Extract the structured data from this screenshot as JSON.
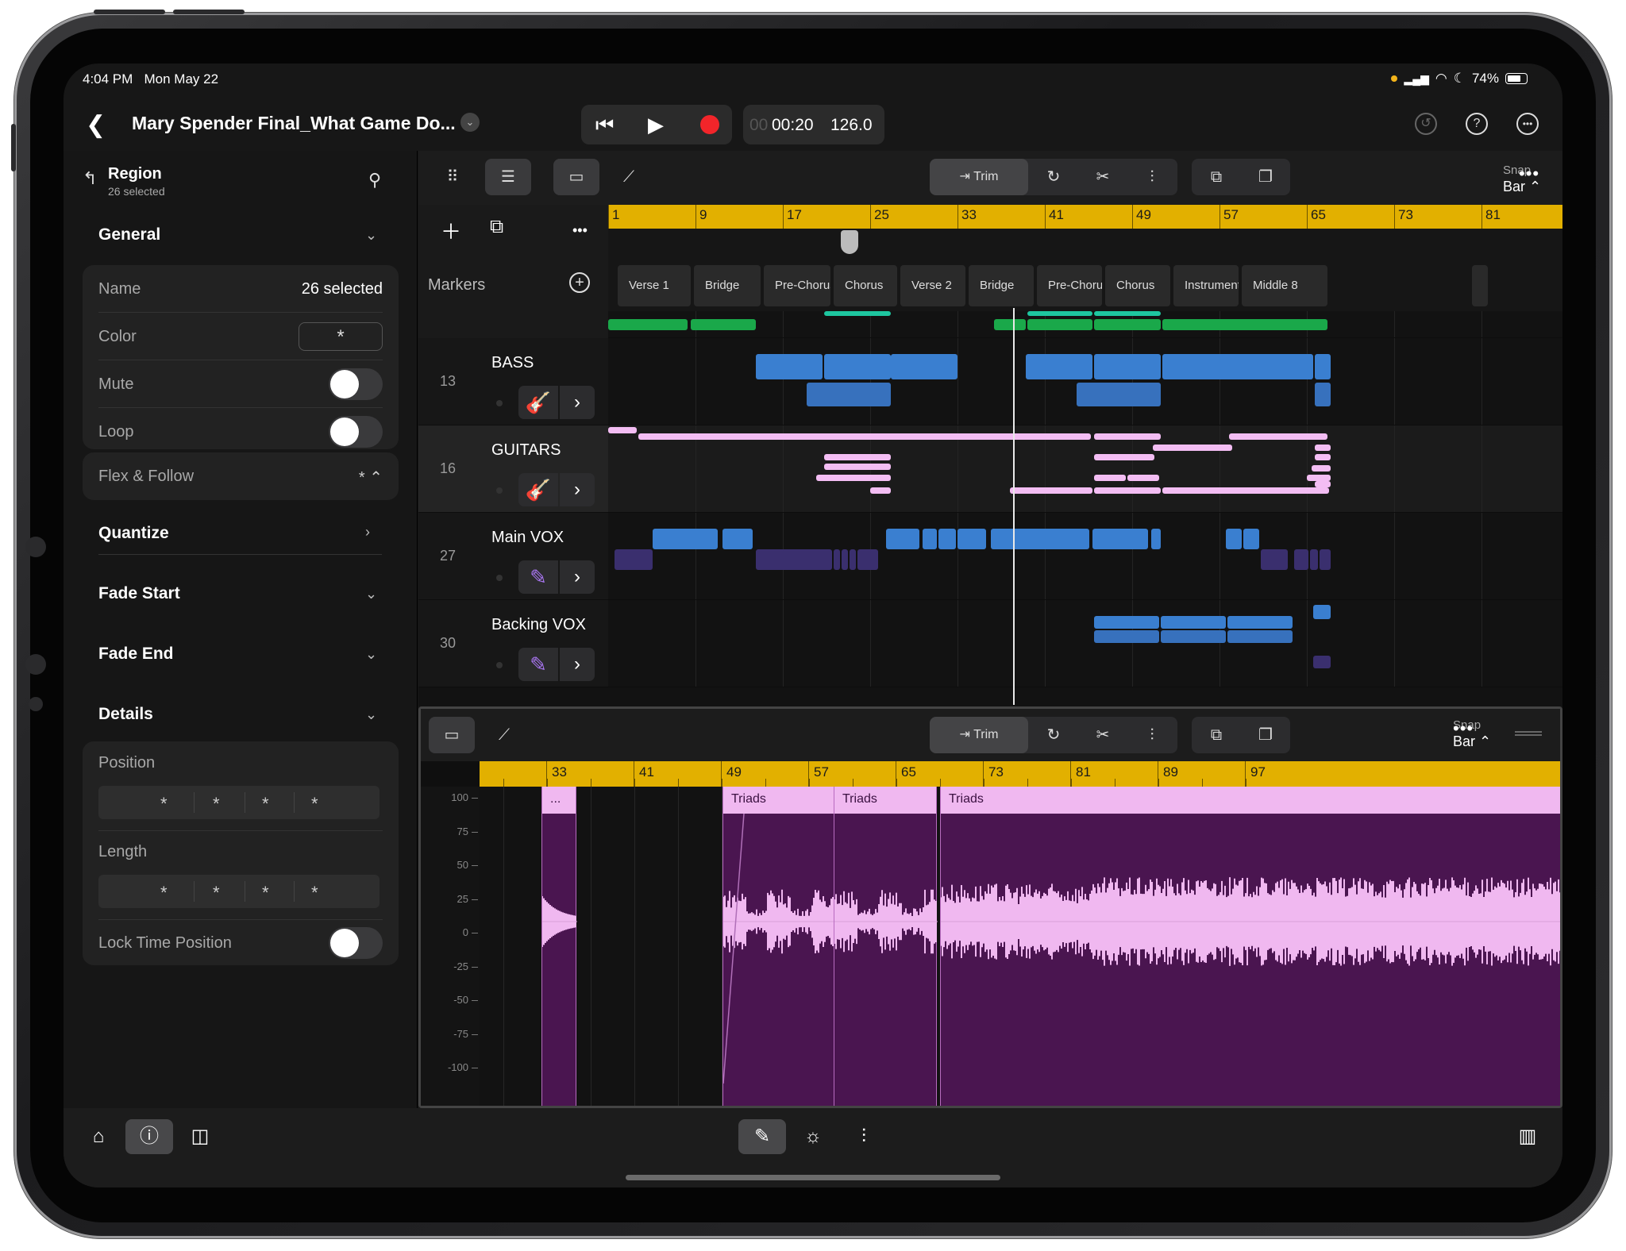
{
  "status": {
    "time": "4:04 PM",
    "date": "Mon May 22",
    "battery": "74%"
  },
  "header": {
    "title": "Mary Spender Final_What Game Do...",
    "lcd_prefix": "00",
    "lcd_time": "00:20",
    "lcd_tempo": "126.0"
  },
  "inspector": {
    "title": "Region",
    "subtitle": "26 selected",
    "sections": {
      "general": "General",
      "quantize": "Quantize",
      "fade_start": "Fade Start",
      "fade_end": "Fade End",
      "details": "Details"
    },
    "rows": {
      "name_label": "Name",
      "name_value": "26 selected",
      "color_label": "Color",
      "color_value": "*",
      "mute_label": "Mute",
      "loop_label": "Loop",
      "flex_label": "Flex & Follow",
      "flex_value": "*",
      "position_label": "Position",
      "length_label": "Length",
      "lock_label": "Lock Time Position",
      "field_value": "*"
    }
  },
  "toolbar": {
    "trim_label": "Trim",
    "snap_label": "Snap",
    "snap_value": "Bar"
  },
  "ruler": [
    "1",
    "9",
    "17",
    "25",
    "33",
    "41",
    "49",
    "57",
    "65",
    "73",
    "81"
  ],
  "markers_label": "Markers",
  "markers": [
    "Verse 1",
    "Bridge",
    "Pre-Chorus",
    "Chorus",
    "Verse 2",
    "Bridge",
    "Pre-Chorus",
    "Chorus",
    "Instrumenta",
    "Middle 8"
  ],
  "tracks": [
    {
      "num": "13",
      "name": "BASS"
    },
    {
      "num": "16",
      "name": "GUITARS"
    },
    {
      "num": "27",
      "name": "Main VOX"
    },
    {
      "num": "30",
      "name": "Backing VOX"
    }
  ],
  "editor": {
    "ruler": [
      "33",
      "41",
      "49",
      "57",
      "65",
      "73",
      "81",
      "89",
      "97"
    ],
    "y_ticks": [
      "100",
      "75",
      "50",
      "25",
      "0",
      "-25",
      "-50",
      "-75",
      "-100"
    ],
    "clips": [
      "...",
      "Triads",
      "Triads",
      "Triads"
    ]
  },
  "colors": {
    "ruler": "#e2b000",
    "bass": "#3a7fd0",
    "guitar": "#f3bdf3",
    "vox": "#3a2f6e",
    "record": "#f2252a"
  }
}
